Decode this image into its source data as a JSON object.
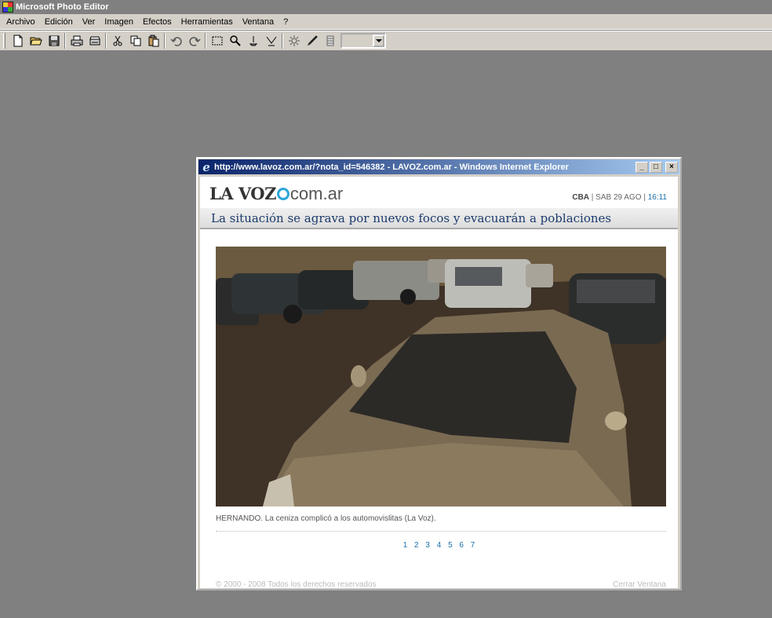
{
  "app": {
    "title": "Microsoft Photo Editor",
    "menu": [
      "Archivo",
      "Edición",
      "Ver",
      "Imagen",
      "Efectos",
      "Herramientas",
      "Ventana",
      "?"
    ],
    "zoom_value": ""
  },
  "browser": {
    "title": "http://www.lavoz.com.ar/?nota_id=546382 - LAVOZ.com.ar - Windows Internet Explorer",
    "buttons": {
      "minimize": "_",
      "maximize": "□",
      "close": "×"
    }
  },
  "page": {
    "logo_main": "LA VOZ",
    "logo_suffix": "com.ar",
    "city": "CBA",
    "date": "SAB 29 AGO",
    "time": "16:11",
    "headline": "La situación se agrava por nuevos focos y evacuarán a poblaciones",
    "caption": "HERNANDO. La ceniza complicó a los automovislitas (La Voz).",
    "pages": [
      "1",
      "2",
      "3",
      "4",
      "5",
      "6",
      "7"
    ],
    "copyright": "© 2000 - 2008 Todos los derechos reservados",
    "close_window": "Cerrar Ventana"
  }
}
